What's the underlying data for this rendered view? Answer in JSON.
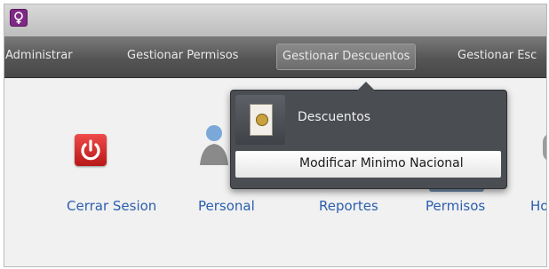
{
  "menubar": {
    "items": [
      {
        "label": "Administrar"
      },
      {
        "label": "Gestionar Permisos"
      },
      {
        "label": "Gestionar Descuentos",
        "active": true
      },
      {
        "label": "Gestionar Esc"
      }
    ]
  },
  "toolbar": {
    "tools": [
      {
        "label": "Cerrar Sesion",
        "icon": "power-icon"
      },
      {
        "label": "Personal",
        "icon": "person-icon"
      },
      {
        "label": "Reportes",
        "icon": "reports-icon"
      },
      {
        "label": "Permisos",
        "icon": "permissions-icon"
      },
      {
        "label": "Ho"
      }
    ]
  },
  "dropdown": {
    "header": {
      "label": "Descuentos",
      "icon": "document-coin-icon"
    },
    "items": [
      {
        "label": "Modificar Minimo Nacional"
      }
    ]
  },
  "colors": {
    "menubar": "#555555",
    "link": "#2b5fae",
    "dropdown": "#4a4d52",
    "app_icon": "#7e2a85"
  }
}
